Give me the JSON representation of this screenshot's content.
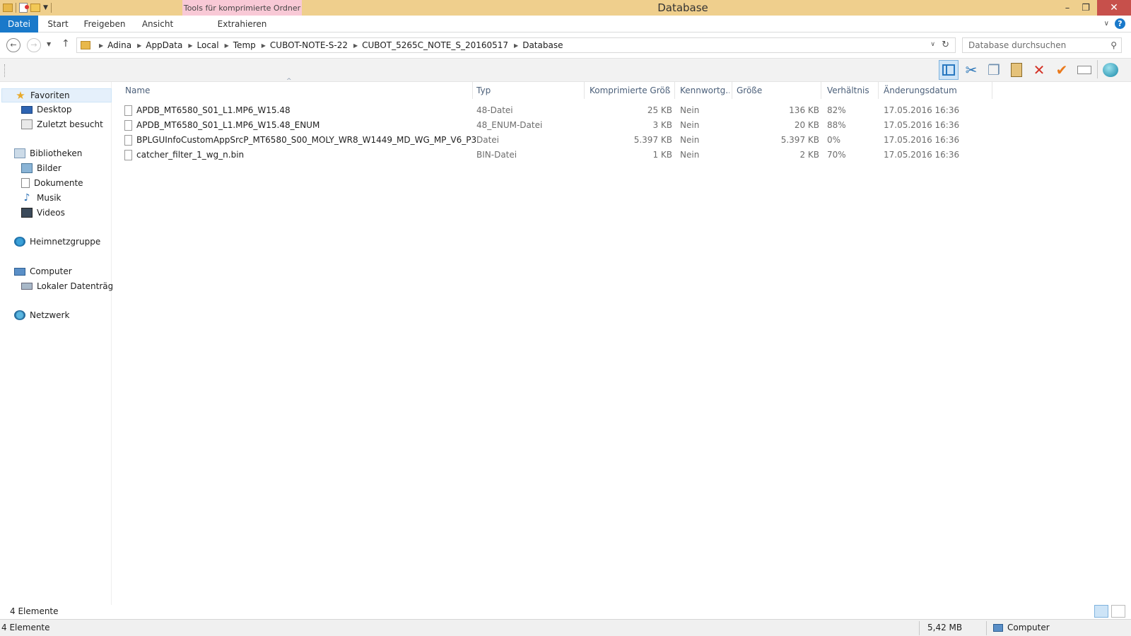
{
  "window": {
    "title": "Database",
    "context_tab": "Tools für komprimierte Ordner"
  },
  "ribbon": {
    "tabs": [
      "Datei",
      "Start",
      "Freigeben",
      "Ansicht"
    ],
    "context_tab_label": "Extrahieren"
  },
  "address": {
    "crumbs": [
      "Adina",
      "AppData",
      "Local",
      "Temp",
      "CUBOT-NOTE-S-22",
      "CUBOT_5265C_NOTE_S_20160517",
      "Database"
    ]
  },
  "search": {
    "placeholder": "Database durchsuchen"
  },
  "toolbar": {
    "icons": [
      "layout-pane-icon",
      "cut-icon",
      "copy-icon",
      "paste-icon",
      "delete-icon",
      "test-check-icon",
      "rename-icon",
      "globe-icon"
    ]
  },
  "sidebar": {
    "favorites": {
      "label": "Favoriten",
      "items": [
        "Desktop",
        "Zuletzt besucht"
      ]
    },
    "libraries": {
      "label": "Bibliotheken",
      "items": [
        "Bilder",
        "Dokumente",
        "Musik",
        "Videos"
      ]
    },
    "homegroup": "Heimnetzgruppe",
    "computer": {
      "label": "Computer",
      "items": [
        "Lokaler Datenträger"
      ]
    },
    "network": "Netzwerk"
  },
  "columns": [
    "Name",
    "Typ",
    "Komprimierte Größe",
    "Kennwortg...",
    "Größe",
    "Verhältnis",
    "Änderungsdatum"
  ],
  "files": [
    {
      "name": "APDB_MT6580_S01_L1.MP6_W15.48",
      "type": "48-Datei",
      "compressed": "25 KB",
      "password": "Nein",
      "size": "136 KB",
      "ratio": "82%",
      "modified": "17.05.2016 16:36"
    },
    {
      "name": "APDB_MT6580_S01_L1.MP6_W15.48_ENUM",
      "type": "48_ENUM-Datei",
      "compressed": "3 KB",
      "password": "Nein",
      "size": "20 KB",
      "ratio": "88%",
      "modified": "17.05.2016 16:36"
    },
    {
      "name": "BPLGUInfoCustomAppSrcP_MT6580_S00_MOLY_WR8_W1449_MD_WG_MP_V6_P3",
      "type": "Datei",
      "compressed": "5.397 KB",
      "password": "Nein",
      "size": "5.397 KB",
      "ratio": "0%",
      "modified": "17.05.2016 16:36"
    },
    {
      "name": "catcher_filter_1_wg_n.bin",
      "type": "BIN-Datei",
      "compressed": "1 KB",
      "password": "Nein",
      "size": "2 KB",
      "ratio": "70%",
      "modified": "17.05.2016 16:36"
    }
  ],
  "status": {
    "item_count": "4 Elemente",
    "bar_count": "4 Elemente",
    "total_size": "5,42 MB",
    "zone": "Computer"
  }
}
